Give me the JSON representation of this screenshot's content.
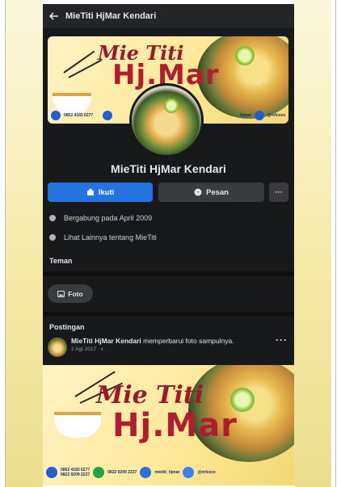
{
  "topbar": {
    "title": "MieTiti HjMar Kendari"
  },
  "cover": {
    "script_text": "Mie Titi",
    "brand_text": "Hj.Mar",
    "phone_primary": "0852 4183 6277",
    "tag_fragment": "hjmar",
    "handle": "@nrlcece"
  },
  "page": {
    "name": "MieTiti HjMar Kendari"
  },
  "actions": {
    "follow_label": "Ikuti",
    "message_label": "Pesan",
    "more_label": "···"
  },
  "info": {
    "joined": "Bergabung pada April 2009",
    "see_more": "Lihat Lainnya tentang MieTiti"
  },
  "sections": {
    "friends": "Teman",
    "photos": "Foto",
    "posts": "Postingan"
  },
  "post": {
    "author": "MieTiti HjMar Kendari",
    "action": "memperbarui foto sampulnya.",
    "date": "2 Agt 2017 ·",
    "more": "···"
  },
  "post_image": {
    "script_text": "Mie Titi",
    "brand_text": "Hj.Mar",
    "phone_1": "0852 4183 6277",
    "phone_2": "0822 9209 2227",
    "whatsapp": "0822 9209 2227",
    "instagram": "mietiti_hjmar",
    "handle": "@nrlcece"
  },
  "colors": {
    "facebook_blue": "#2374e1",
    "dark_bg": "#18191a",
    "card_dark": "#3a3b3c",
    "brand_red": "#b01e2e"
  }
}
